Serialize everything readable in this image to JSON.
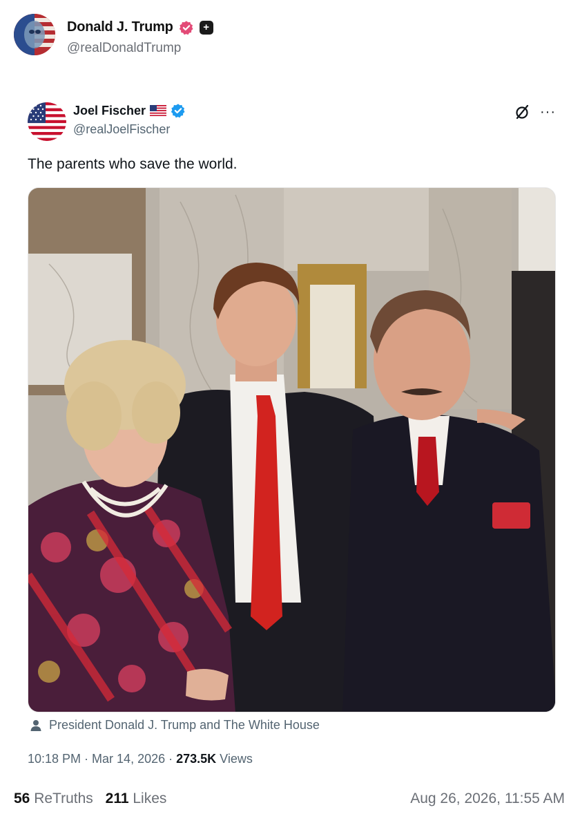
{
  "outer": {
    "name": "Donald J. Trump",
    "handle": "@realDonaldTrump",
    "plus_badge": "+"
  },
  "post": {
    "name": "Joel Fischer",
    "handle": "@realJoelFischer",
    "text": "The parents who save the world.",
    "more_label": "···",
    "photo_credit": "President Donald J. Trump and The White House",
    "time": "10:18 PM",
    "separator1": " · ",
    "date": "Mar 14, 2026",
    "separator2": " · ",
    "views_count": "273.5K",
    "views_label": " Views"
  },
  "footer": {
    "retruths_count": "56",
    "retruths_label": "ReTruths",
    "likes_count": "211",
    "likes_label": "Likes",
    "timestamp": "Aug 26, 2026, 11:55 AM"
  },
  "colors": {
    "truth_badge": "#e34b77",
    "x_verified": "#1d9bf0",
    "tie_red": "#d2231f",
    "text_muted": "#536471"
  },
  "icons": {
    "verified": "verified-badge-icon",
    "plus": "plus-badge-icon",
    "flag": "us-flag-icon",
    "grok": "grok-icon",
    "more": "more-icon",
    "person": "person-icon"
  }
}
